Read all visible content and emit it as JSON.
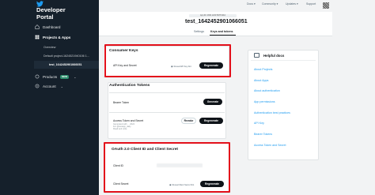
{
  "brand": {
    "title": "Developer\nPortal",
    "logo_icon": "twitter-bird-icon"
  },
  "sidebar": {
    "items": [
      {
        "label": "Dashboard",
        "icon": "home-icon"
      },
      {
        "label": "Projects & Apps",
        "icon": "projects-icon"
      },
      {
        "label": "Overview"
      },
      {
        "label": "Default project-1624521940106 1..."
      },
      {
        "label": "test_1642452901066051"
      },
      {
        "label": "Products",
        "badge": "NEW",
        "icon": "products-icon"
      },
      {
        "label": "Account",
        "icon": "account-icon"
      }
    ]
  },
  "topnav": {
    "docs": "Docs ▾",
    "community": "Community ▾",
    "updates": "Updates ▾",
    "support": "Support"
  },
  "app": {
    "id_label": "App ID: 2309 1234 5678 9012",
    "title": "test_1642452901066051",
    "tabs": [
      {
        "label": "Settings"
      },
      {
        "label": "Keys and tokens"
      }
    ]
  },
  "consumer_keys": {
    "title": "Consumer Keys",
    "row_label": "API Key and Secret",
    "reveal": "Reveal API Key hint",
    "button": "Regenerate"
  },
  "auth_tokens": {
    "title": "Authentication Tokens",
    "bearer_label": "Bearer Token",
    "bearer_button": "Generate",
    "access_label": "Access Token and Secret",
    "access_sub1": "Generated with ... 2024",
    "access_sub2": "For @testapp_daily",
    "access_sub3": "Read and write",
    "revoke_button": "Revoke",
    "access_button": "Regenerate"
  },
  "oauth": {
    "title": "OAuth 2.0 Client ID and Client Secret",
    "client_id_label": "Client ID",
    "client_secret_label": "Client Secret",
    "reveal": "Reveal Client Secret hint",
    "button": "Regenerate"
  },
  "docs": {
    "title": "Helpful docs",
    "links": [
      "About Projects",
      "About Apps",
      "About authentication",
      "App permissions",
      "Authentication best practices",
      "API Key",
      "Bearer Tokens",
      "Access Token and Secret"
    ]
  },
  "colors": {
    "sidebar": "#15202b",
    "highlight": "#e3101b",
    "link": "#1d9bf0",
    "button": "#0f1419"
  }
}
